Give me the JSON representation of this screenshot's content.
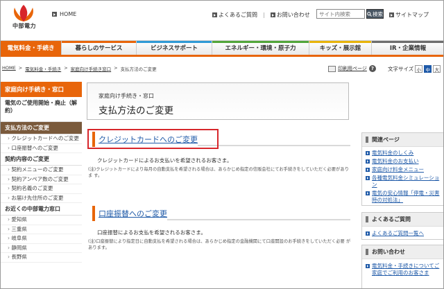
{
  "header": {
    "logo_text": "中部電力",
    "home": "HOME",
    "links": [
      "よくあるご質問",
      "お問い合わせ"
    ],
    "search_placeholder": "サイト内検索",
    "search_button": "検索",
    "sitemap": "サイトマップ"
  },
  "gnav": [
    {
      "label": "電気料金・手続き",
      "color": "#e8650a"
    },
    {
      "label": "暮らしのサービス",
      "color": "#e8650a"
    },
    {
      "label": "ビジネスサポート",
      "color": "#2f9ad6"
    },
    {
      "label": "エネルギー・環境・原子力",
      "color": "#52a63a"
    },
    {
      "label": "キッズ・展示館",
      "color": "#e8b40a"
    },
    {
      "label": "IR・企業情報",
      "color": "#6d6d6d"
    }
  ],
  "breadcrumbs": [
    "HOME",
    "電気料金・手続き",
    "家庭向け手続き窓口",
    "支払方法のご変更"
  ],
  "print_label": "印刷用ページ",
  "fontsize": {
    "label": "文字サイズ",
    "options": [
      "小",
      "中",
      "大"
    ]
  },
  "sidebar": {
    "title": "家庭向け手続き・窓口",
    "sections": [
      {
        "label": "電気のご使用開始・廃止（解約）",
        "subs": []
      },
      {
        "label": "支払方法のご変更",
        "subs": [
          "クレジットカードへのご変更",
          "口座振替へのご変更"
        ],
        "highlight": true
      },
      {
        "label": "契約内容のご変更",
        "subs": [
          "契約メニューのご変更",
          "契約アンペア数のご変更",
          "契約名義のご変更",
          "お届け先住所のご変更"
        ]
      },
      {
        "label": "お近くの中部電力窓口",
        "subs": [
          "愛知県",
          "三重県",
          "岐阜県",
          "静岡県",
          "長野県"
        ]
      }
    ]
  },
  "main": {
    "category": "家庭向け手続き・窓口",
    "title": "支払方法のご変更",
    "credit": {
      "title": "クレジットカードへのご変更",
      "text": "クレジットカードによるお支払いを希望されるお客さま。",
      "note": "(注)クレジットカードにより毎月の自動支払を希望される場合は、あらかじめ指定の信販会社にてお手続きをしていただく必要がありま す。"
    },
    "bank": {
      "title": "口座振替へのご変更",
      "text": "口座振替によるお支払を希望されるお客さま。",
      "note": "(注)口座振替により指定日に自動支払を希望される場合は、あらかじめ指定の金融機関にて口座開設のお手続きをしていただく必要 があります。"
    }
  },
  "right": {
    "related": {
      "title": "関連ページ",
      "links": [
        "電気料金のしくみ",
        "電気料金のお支払い",
        "家庭向け料金メニュー",
        "各種電気料金シミュレーション",
        "電気の安心情報「停電・災害時の対処法」"
      ]
    },
    "faq": {
      "title": "よくあるご質問",
      "links": [
        "よくあるご質問一覧へ"
      ]
    },
    "contact": {
      "title": "お問い合わせ",
      "links": [
        "電気料金・手続きについてご家庭でご利用のお客さま"
      ]
    }
  }
}
